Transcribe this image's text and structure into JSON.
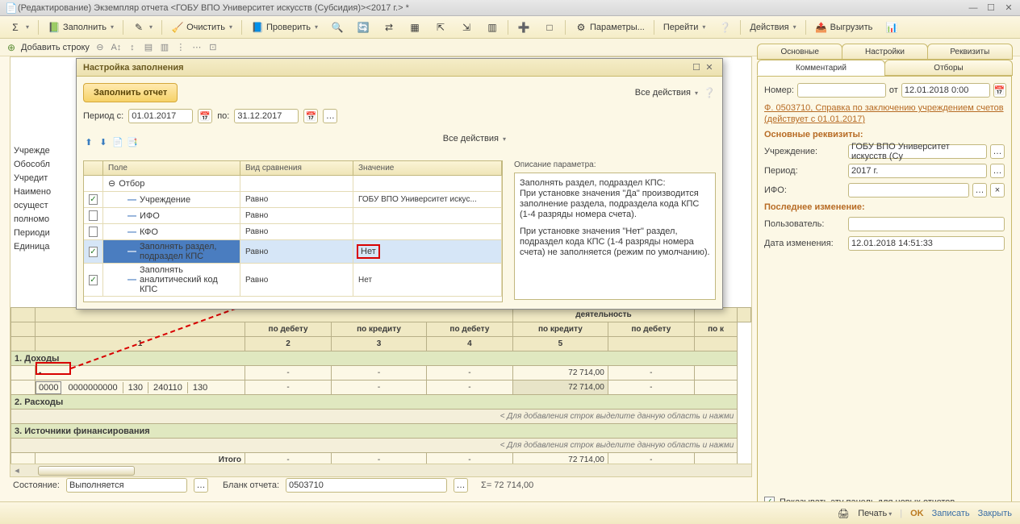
{
  "window": {
    "title": "(Редактирование) Экземпляр отчета <ГОБУ ВПО Университет искусств (Субсидия)><2017 г.> *"
  },
  "toolbar": {
    "fill": "Заполнить",
    "clear": "Очистить",
    "check": "Проверить",
    "params": "Параметры...",
    "goto": "Перейти",
    "actions": "Действия",
    "export": "Выгрузить"
  },
  "subtoolbar": {
    "add_row": "Добавить строку"
  },
  "left_labels": [
    "Учрежде",
    "Обособл",
    "Учредит",
    "Наимено",
    "осущест",
    "полномо",
    "Периоди",
    "",
    "Единица"
  ],
  "dialog": {
    "title": "Настройка заполнения",
    "fill_report": "Заполнить отчет",
    "all_actions": "Все действия",
    "period_from_lbl": "Период с:",
    "period_from": "01.01.2017",
    "period_to_lbl": "по:",
    "period_to": "31.12.2017",
    "desc_hdr": "Описание параметра:",
    "desc_text1": "Заполнять раздел, подраздел КПС:\nПри установке значения \"Да\" производится заполнение раздела, подраздела кода КПС (1-4 разряды номера счета).",
    "desc_text2": "При установке значения \"Нет\" раздел, подраздел кода КПС (1-4 разряды номера счета) не заполняется (режим по умолчанию).",
    "cols": {
      "field": "Поле",
      "cmp": "Вид сравнения",
      "val": "Значение"
    },
    "rows": {
      "otbor": "Отбор",
      "r1": {
        "f": "Учреждение",
        "c": "Равно",
        "v": "ГОБУ ВПО Университет искус..."
      },
      "r2": {
        "f": "ИФО",
        "c": "Равно",
        "v": ""
      },
      "r3": {
        "f": "КФО",
        "c": "Равно",
        "v": ""
      },
      "r4": {
        "f": "Заполнять раздел, подраздел КПС",
        "c": "Равно",
        "v": "Нет"
      },
      "r5": {
        "f": "Заполнять аналитический код КПС",
        "c": "Равно",
        "v": "Нет"
      }
    }
  },
  "table": {
    "sub_hdr": "деятельность",
    "cols": {
      "deb": "по дебету",
      "cred": "по кредиту"
    },
    "nums": [
      "1",
      "2",
      "3",
      "4",
      "5"
    ],
    "sec1": "1. Доходы",
    "sec2": "2. Расходы",
    "sec3": "3. Источники финансирования",
    "row_vals": {
      "a": "0000",
      "b": "0000000000",
      "c": "130",
      "d": "240110",
      "e": "130"
    },
    "amount": "72 714,00",
    "hint": "< Для добавления строк выделите данную область и нажми",
    "itogo": "Итого"
  },
  "status": {
    "state_lbl": "Состояние:",
    "state": "Выполняется",
    "blank_lbl": "Бланк отчета:",
    "blank": "0503710",
    "sigma": "Σ=  72 714,00"
  },
  "side_tabs": {
    "t1": "Основные",
    "t2": "Настройки",
    "t3": "Реквизиты",
    "t4": "Комментарий",
    "t5": "Отборы"
  },
  "side": {
    "num_lbl": "Номер:",
    "ot": "от",
    "date": "12.01.2018 0:00",
    "form_link": "Ф. 0503710, Справка по заключению учреждением счетов (действует с 01.01.2017)",
    "main_req": "Основные реквизиты:",
    "uchr_lbl": "Учреждение:",
    "uchr": "ГОБУ ВПО Университет искусств (Су",
    "period_lbl": "Период:",
    "period": "2017 г.",
    "ifo_lbl": "ИФО:",
    "ifo": "",
    "last_lbl": "Последнее изменение:",
    "user_lbl": "Пользователь:",
    "user": "",
    "chg_lbl": "Дата изменения:",
    "chg": "12.01.2018 14:51:33",
    "show_panel": "Показывать эту панель для новых отчетов"
  },
  "bottom": {
    "print": "Печать",
    "ok": "OK",
    "save": "Записать",
    "close": "Закрыть"
  }
}
